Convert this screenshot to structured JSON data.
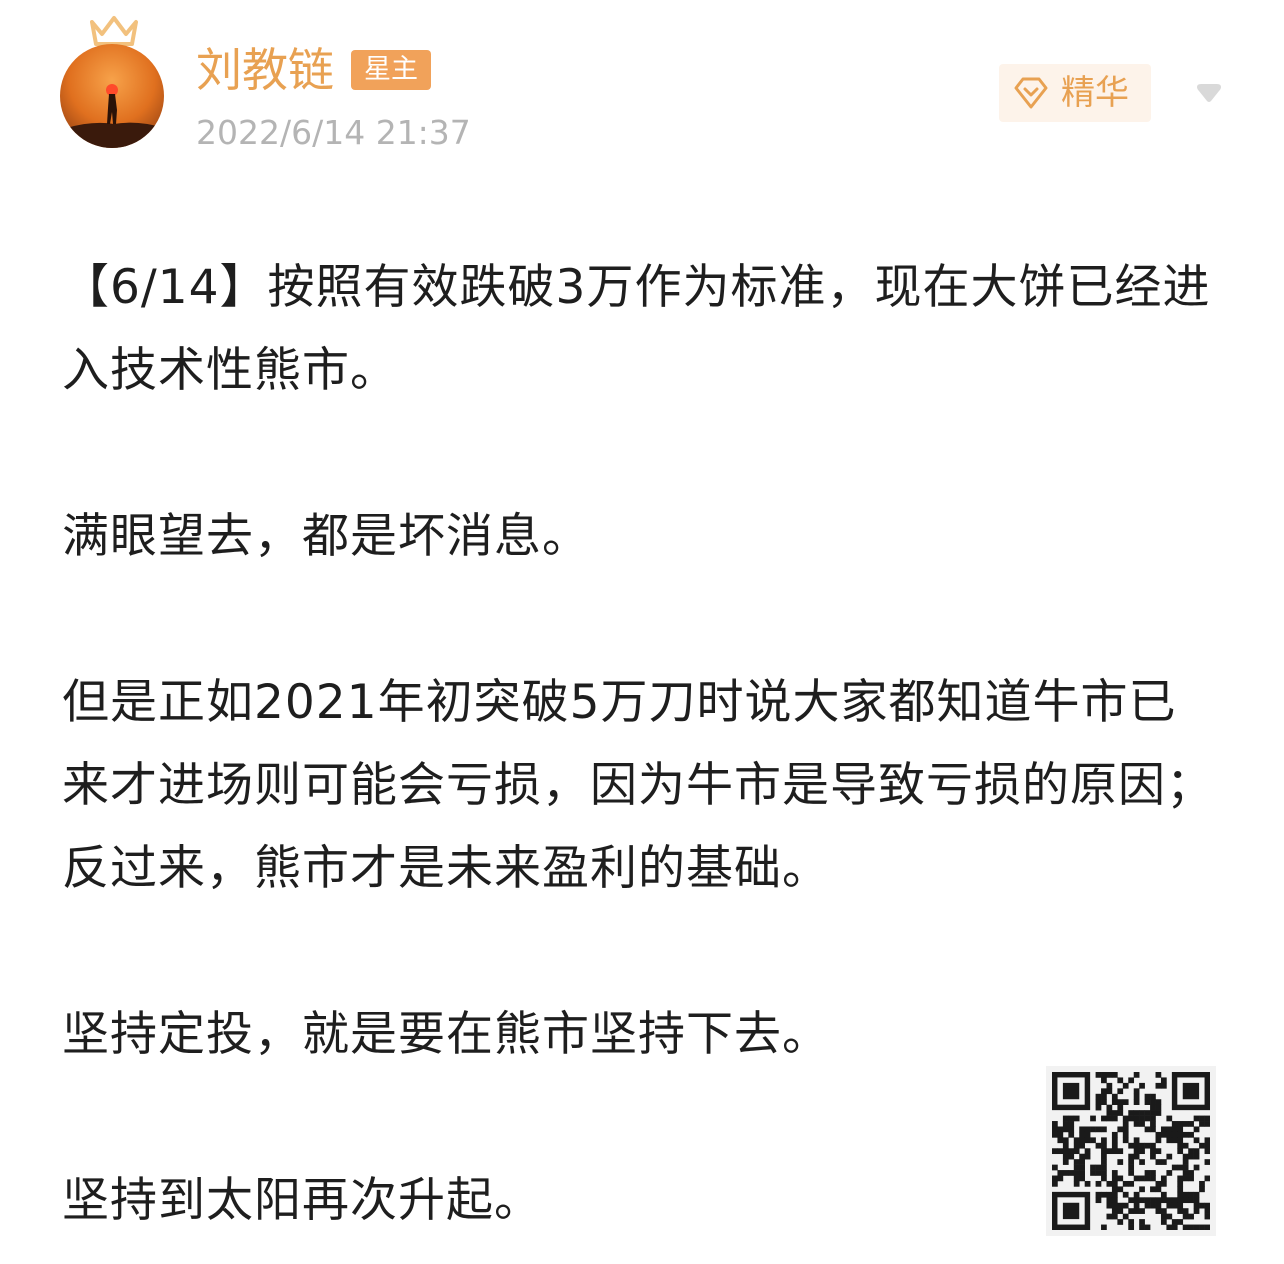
{
  "post": {
    "author": {
      "name": "刘教链",
      "badge": "星主",
      "avatar_icon": "avatar-silhouette-sunset",
      "crown_icon": "crown-icon"
    },
    "timestamp": "2022/6/14 21:37",
    "featured": {
      "label": "精华",
      "icon": "diamond-icon"
    },
    "menu_icon": "chevron-down-icon",
    "paragraphs": [
      "【6/14】按照有效跌破3万作为标准，现在大饼已经进入技术性熊市。",
      "满眼望去，都是坏消息。",
      "但是正如2021年初突破5万刀时说大家都知道牛市已来才进场则可能会亏损，因为牛市是导致亏损的原因；反过来，熊市才是未来盈利的基础。",
      "坚持定投，就是要在熊市坚持下去。",
      "坚持到太阳再次升起。"
    ],
    "qr_icon": "qr-code-icon"
  },
  "colors": {
    "accent": "#e8a152",
    "badge_bg": "#f1a25a",
    "featured_bg": "#fdf3ea",
    "timestamp": "#b4b4b4",
    "text": "#1e1e1e"
  }
}
